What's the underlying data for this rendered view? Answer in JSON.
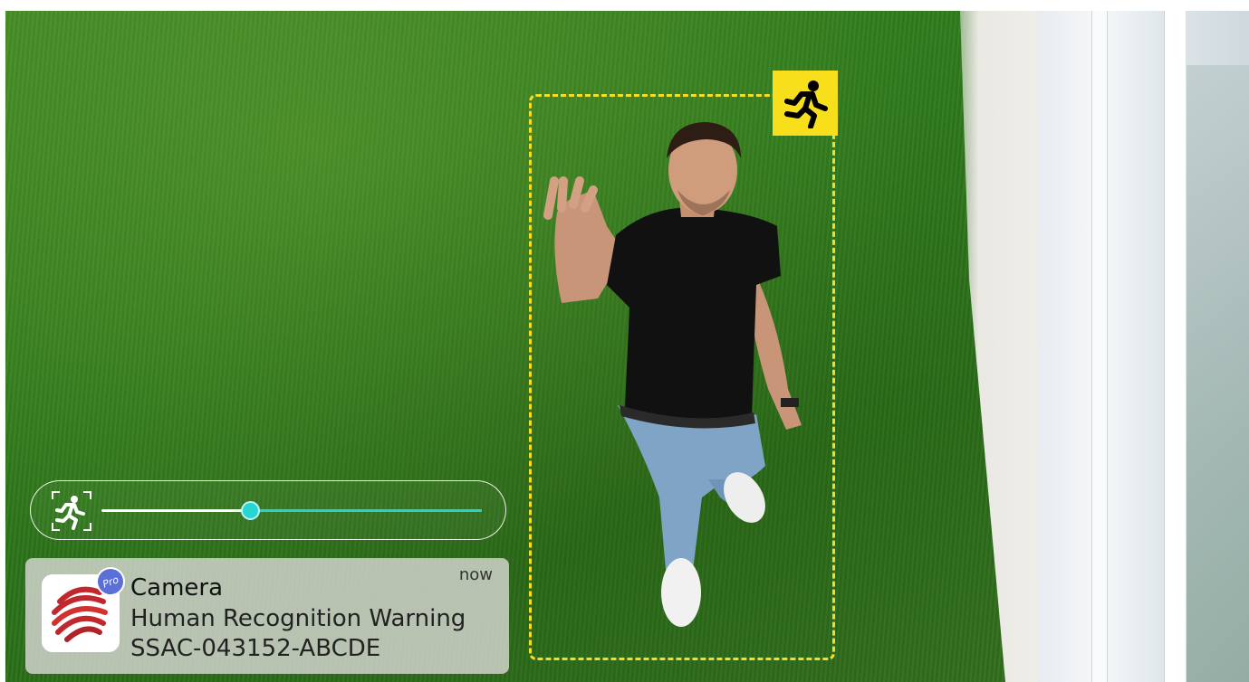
{
  "colors": {
    "detection_accent": "#f5dd22",
    "slider_accent": "#22d3cf",
    "notification_bg": "#d7d7d2"
  },
  "detection": {
    "badge_icon": "running-person-icon"
  },
  "sensitivity_slider": {
    "icon": "motion-detect-person-icon",
    "value_fraction": 0.39
  },
  "notification": {
    "app_icon": "camera-app-icon",
    "badge": "Pro",
    "app_name": "Camera",
    "time": "now",
    "message": "Human Recognition Warning",
    "device_id": "SSAC-043152-ABCDE"
  }
}
